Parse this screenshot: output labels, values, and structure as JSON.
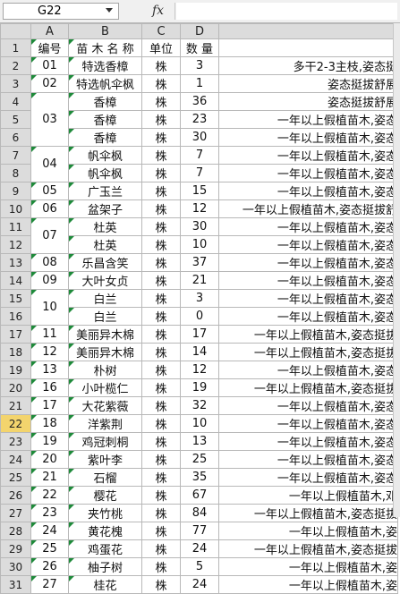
{
  "namebox": "G22",
  "fx_label": "fx",
  "columns": [
    "A",
    "B",
    "C",
    "D"
  ],
  "selected_row": "22",
  "rows": [
    {
      "n": "1",
      "a": "编号",
      "b": "苗 木 名 称",
      "c": "单位",
      "d": "数 量",
      "e": ""
    },
    {
      "n": "2",
      "a": "01",
      "b": "特选香樟",
      "c": "株",
      "d": "3",
      "e": "多干2-3主枝,姿态挺"
    },
    {
      "n": "3",
      "a": "02",
      "b": "特选帆伞枫",
      "c": "株",
      "d": "1",
      "e": "姿态挺拔舒展"
    },
    {
      "n": "4",
      "a": "",
      "b": "香樟",
      "c": "株",
      "d": "36",
      "e": "姿态挺拔舒展"
    },
    {
      "n": "5",
      "a": "",
      "b": "香樟",
      "c": "株",
      "d": "23",
      "e": "一年以上假植苗木,姿态"
    },
    {
      "n": "6",
      "a": "03",
      "b": "香樟",
      "c": "株",
      "d": "30",
      "e": "一年以上假植苗木,姿态"
    },
    {
      "n": "7",
      "a": "",
      "b": "帆伞枫",
      "c": "株",
      "d": "7",
      "e": "一年以上假植苗木,姿态"
    },
    {
      "n": "8",
      "a": "04",
      "b": "帆伞枫",
      "c": "株",
      "d": "7",
      "e": "一年以上假植苗木,姿态"
    },
    {
      "n": "9",
      "a": "05",
      "b": "广玉兰",
      "c": "株",
      "d": "15",
      "e": "一年以上假植苗木,姿态"
    },
    {
      "n": "10",
      "a": "06",
      "b": "盆架子",
      "c": "株",
      "d": "12",
      "e": "一年以上假植苗木,姿态挺拔舒"
    },
    {
      "n": "11",
      "a": "",
      "b": "杜英",
      "c": "株",
      "d": "30",
      "e": "一年以上假植苗木,姿态"
    },
    {
      "n": "12",
      "a": "07",
      "b": "杜英",
      "c": "株",
      "d": "10",
      "e": "一年以上假植苗木,姿态"
    },
    {
      "n": "13",
      "a": "08",
      "b": "乐昌含笑",
      "c": "株",
      "d": "37",
      "e": "一年以上假植苗木,姿态"
    },
    {
      "n": "14",
      "a": "09",
      "b": "大叶女贞",
      "c": "株",
      "d": "21",
      "e": "一年以上假植苗木,姿态"
    },
    {
      "n": "15",
      "a": "",
      "b": "白兰",
      "c": "株",
      "d": "3",
      "e": "一年以上假植苗木,姿态"
    },
    {
      "n": "16",
      "a": "10",
      "b": "白兰",
      "c": "株",
      "d": "0",
      "e": "一年以上假植苗木,姿态"
    },
    {
      "n": "17",
      "a": "11",
      "b": "美丽异木棉",
      "c": "株",
      "d": "17",
      "e": "一年以上假植苗木,姿态挺拔"
    },
    {
      "n": "18",
      "a": "12",
      "b": "美丽异木棉",
      "c": "株",
      "d": "14",
      "e": "一年以上假植苗木,姿态挺拔"
    },
    {
      "n": "19",
      "a": "13",
      "b": "朴树",
      "c": "株",
      "d": "12",
      "e": "一年以上假植苗木,姿态"
    },
    {
      "n": "20",
      "a": "16",
      "b": "小叶榄仁",
      "c": "株",
      "d": "19",
      "e": "一年以上假植苗木,姿态挺拔"
    },
    {
      "n": "21",
      "a": "17",
      "b": "大花紫薇",
      "c": "株",
      "d": "32",
      "e": "一年以上假植苗木,姿态"
    },
    {
      "n": "22",
      "a": "18",
      "b": "洋紫荆",
      "c": "株",
      "d": "10",
      "e": "一年以上假植苗木,姿态"
    },
    {
      "n": "23",
      "a": "19",
      "b": "鸡冠刺桐",
      "c": "株",
      "d": "13",
      "e": "一年以上假植苗木,姿态"
    },
    {
      "n": "24",
      "a": "20",
      "b": "紫叶李",
      "c": "株",
      "d": "25",
      "e": "一年以上假植苗木,姿态"
    },
    {
      "n": "25",
      "a": "21",
      "b": "石榴",
      "c": "株",
      "d": "35",
      "e": "一年以上假植苗木,姿态"
    },
    {
      "n": "26",
      "a": "22",
      "b": "樱花",
      "c": "株",
      "d": "67",
      "e": "一年以上假植苗木,邓"
    },
    {
      "n": "27",
      "a": "23",
      "b": "夹竹桃",
      "c": "株",
      "d": "84",
      "e": "一年以上假植苗木,姿态挺拔"
    },
    {
      "n": "28",
      "a": "24",
      "b": "黄花槐",
      "c": "株",
      "d": "77",
      "e": "一年以上假植苗木,姿"
    },
    {
      "n": "29",
      "a": "25",
      "b": "鸡蛋花",
      "c": "株",
      "d": "24",
      "e": "一年以上假植苗木,姿态挺拔"
    },
    {
      "n": "30",
      "a": "26",
      "b": "柚子树",
      "c": "株",
      "d": "5",
      "e": "一年以上假植苗木,姿"
    },
    {
      "n": "31",
      "a": "27",
      "b": "桂花",
      "c": "株",
      "d": "24",
      "e": "一年以上假植苗木,姿"
    }
  ]
}
